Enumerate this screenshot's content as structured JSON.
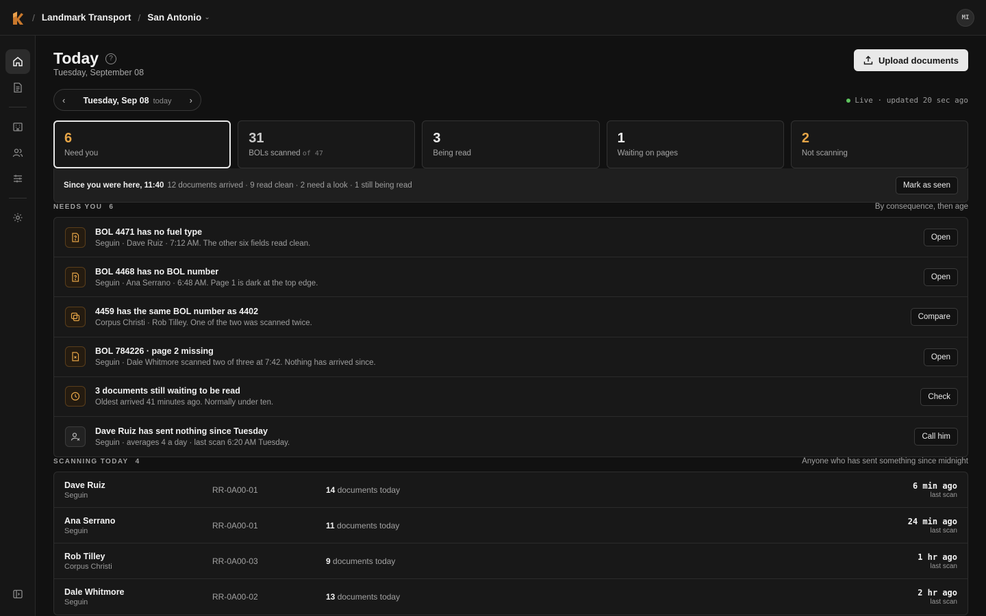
{
  "header": {
    "org": "Landmark Transport",
    "location": "San Antonio",
    "user_initials": "MI"
  },
  "page": {
    "title": "Today",
    "subtitle": "Tuesday, September 08",
    "upload_label": "Upload documents",
    "date_label": "Tuesday, Sep 08",
    "date_tag": "today",
    "live_text": "Live · updated 20 sec ago"
  },
  "stats": [
    {
      "value": "6",
      "label": "Need you"
    },
    {
      "value": "31",
      "label": "BOLs scanned",
      "suffix": "of 47"
    },
    {
      "value": "3",
      "label": "Being read"
    },
    {
      "value": "1",
      "label": "Waiting on pages"
    },
    {
      "value": "2",
      "label": "Not scanning"
    }
  ],
  "since": {
    "lead": "Since you were here, 11:40",
    "detail": "12 documents arrived · 9 read clean · 2 need a look · 1 still being read",
    "button": "Mark as seen"
  },
  "needs": {
    "title": "NEEDS YOU",
    "count": "6",
    "note": "By consequence, then age",
    "items": [
      {
        "title": "BOL 4471 has no fuel type",
        "sub": "Seguin · Dave Ruiz · 7:12 AM. The other six fields read clean.",
        "action": "Open",
        "icon": "doc-question-icon"
      },
      {
        "title": "BOL 4468 has no BOL number",
        "sub": "Seguin · Ana Serrano · 6:48 AM. Page 1 is dark at the top edge.",
        "action": "Open",
        "icon": "doc-question-icon"
      },
      {
        "title": "4459 has the same BOL number as 4402",
        "sub": "Corpus Christi · Rob Tilley. One of the two was scanned twice.",
        "action": "Compare",
        "icon": "duplicate-icon"
      },
      {
        "title": "BOL 784226 · page 2 missing",
        "sub": "Seguin · Dale Whitmore scanned two of three at 7:42. Nothing has arrived since.",
        "action": "Open",
        "icon": "doc-missing-icon"
      },
      {
        "title": "3 documents still waiting to be read",
        "sub": "Oldest arrived 41 minutes ago. Normally under ten.",
        "action": "Check",
        "icon": "clock-icon"
      },
      {
        "title": "Dave Ruiz has sent nothing since Tuesday",
        "sub": "Seguin · averages 4 a day · last scan 6:20 AM Tuesday.",
        "action": "Call him",
        "icon": "user-x-icon"
      }
    ]
  },
  "scanning": {
    "title": "SCANNING TODAY",
    "count": "4",
    "note": "Anyone who has sent something since midnight",
    "docs_suffix": "documents today",
    "last_label": "last scan",
    "rows": [
      {
        "name": "Dave Ruiz",
        "loc": "Seguin",
        "device": "RR-0A00-01",
        "docs": "14",
        "time": "6 min ago"
      },
      {
        "name": "Ana Serrano",
        "loc": "Seguin",
        "device": "RR-0A00-01",
        "docs": "11",
        "time": "24 min ago"
      },
      {
        "name": "Rob Tilley",
        "loc": "Corpus Christi",
        "device": "RR-0A00-03",
        "docs": "9",
        "time": "1 hr ago"
      },
      {
        "name": "Dale Whitmore",
        "loc": "Seguin",
        "device": "RR-0A00-02",
        "docs": "13",
        "time": "2 hr ago"
      }
    ]
  },
  "colors": {
    "accent": "#e6a547",
    "live": "#5fc45f",
    "background": "#111111"
  }
}
